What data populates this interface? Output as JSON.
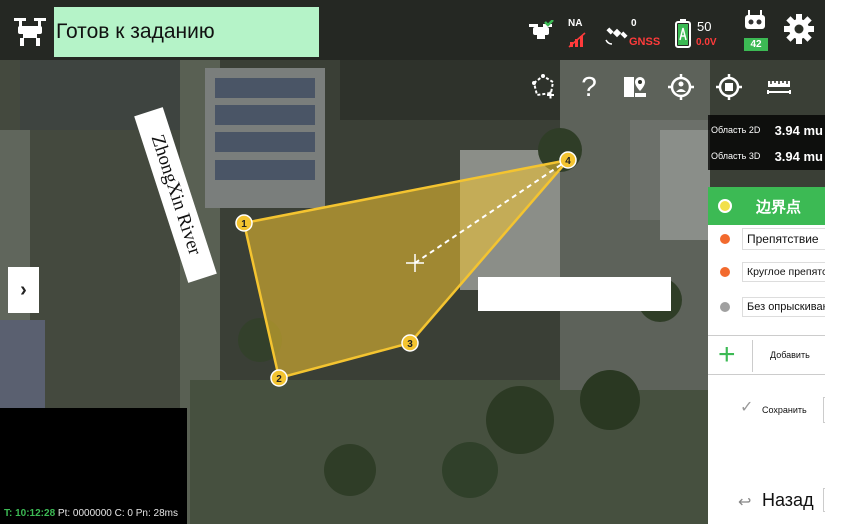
{
  "header": {
    "status": "Готов к заданию",
    "rtk_label": "NA",
    "satellite_count": "0",
    "gnss_label": "GNSS",
    "battery_percent": "50",
    "battery_voltage": "0.0V",
    "controller_badge": "42"
  },
  "area": {
    "area2d_label": "Область 2D",
    "area2d_value": "3.94 mu",
    "area3d_label": "Область 3D",
    "area3d_value": "3.94 mu"
  },
  "map": {
    "river_label": "ZhongXin River",
    "points": [
      "1",
      "2",
      "3",
      "4"
    ]
  },
  "panel": {
    "boundary_label": "边界点",
    "options": [
      {
        "label": "Препятствие",
        "color": "#f26a2e"
      },
      {
        "label": "Круглое препятствие",
        "color": "#f26a2e"
      },
      {
        "label": "Без опрыскивания",
        "color": "#a0a0a0"
      }
    ],
    "add_label": "Добавить",
    "save_label": "Сохранить",
    "back_label": "Назад"
  },
  "telemetry": {
    "time": "T: 10:12:28",
    "pt": "Pt: 0000000",
    "c": "C: 0",
    "pn": "Pn: 28ms"
  },
  "colors": {
    "accent_green": "#3cba54",
    "status_bg": "#b5f3c8",
    "polygon": "#f4c430"
  }
}
